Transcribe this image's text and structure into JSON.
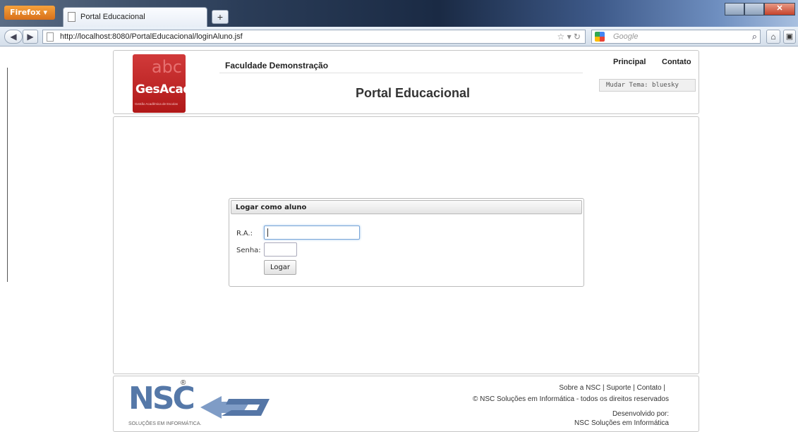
{
  "browser": {
    "menu_label": "Firefox",
    "tab_title": "Portal Educacional",
    "new_tab_label": "+",
    "url": "http://localhost:8080/PortalEducacional/loginAluno.jsf",
    "search_placeholder": "Google"
  },
  "header": {
    "logo_letters": "abc",
    "logo_name": "GesAcad",
    "logo_subtitle": "Gestão Acadêmica de Escolas",
    "college_name": "Faculdade Demonstração",
    "portal_title": "Portal Educacional",
    "nav": [
      "Principal",
      "Contato"
    ],
    "theme_label": "Mudar Tema: bluesky"
  },
  "login": {
    "title": "Logar como aluno",
    "ra_label": "R.A.:",
    "ra_value": "",
    "password_label": "Senha:",
    "password_value": "",
    "submit_label": "Logar"
  },
  "footer": {
    "logo_text": "NSC",
    "logo_reg": "®",
    "logo_subtitle": "SOLUÇÕES EM INFORMÁTICA.",
    "links": "Sobre a NSC |   Suporte |   Contato |",
    "copyright": "© NSC Soluções em Informática - todos os direitos reservados",
    "dev_label": "Desenvolvido por:",
    "dev_name": "NSC Soluções em Informática"
  }
}
